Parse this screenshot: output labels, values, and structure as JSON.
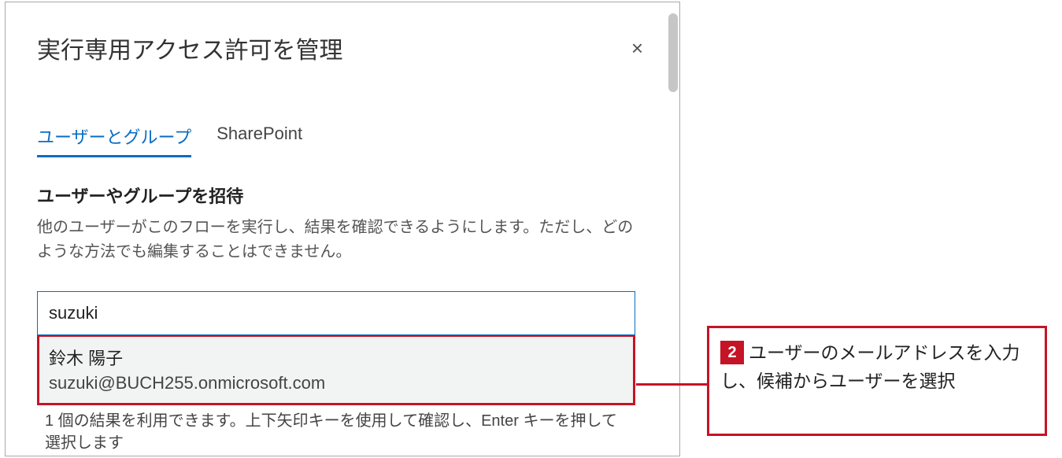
{
  "dialog": {
    "title": "実行専用アクセス許可を管理",
    "close_label": "×"
  },
  "tabs": {
    "users_groups": "ユーザーとグループ",
    "sharepoint": "SharePoint"
  },
  "invite": {
    "heading": "ユーザーやグループを招待",
    "description": "他のユーザーがこのフローを実行し、結果を確認できるようにします。ただし、どのような方法でも編集することはできません。"
  },
  "search": {
    "value": "suzuki"
  },
  "suggestion": {
    "name": "鈴木 陽子",
    "email": "suzuki@BUCH255.onmicrosoft.com"
  },
  "results_hint": "1 個の結果を利用できます。上下矢印キーを使用して確認し、Enter キーを押して選択します",
  "callout": {
    "step_number": "2",
    "text": "ユーザーのメールアドレスを入力し、候補からユーザーを選択"
  }
}
